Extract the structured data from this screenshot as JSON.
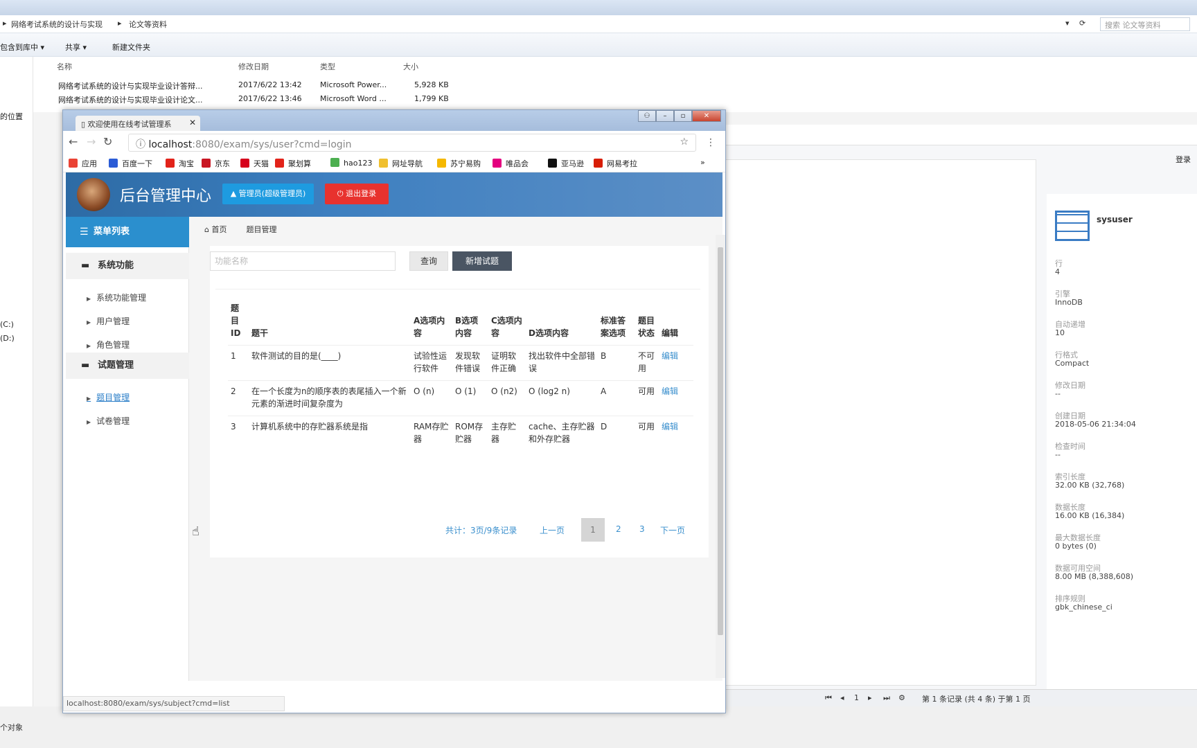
{
  "explorer": {
    "breadcrumb_1": "网络考试系统的设计与实现",
    "breadcrumb_2": "论文等资料",
    "search_placeholder": "搜索 论文等资料",
    "toolbar": [
      "包含到库中 ▾",
      "共享 ▾",
      "新建文件夹"
    ],
    "columns": [
      "名称",
      "修改日期",
      "类型",
      "大小"
    ],
    "files": [
      {
        "name": "网络考试系统的设计与实现毕业设计答辩...",
        "date": "2017/6/22 13:42",
        "type": "Microsoft Power...",
        "size": "5,928 KB"
      },
      {
        "name": "网络考试系统的设计与实现毕业设计论文...",
        "date": "2017/6/22 13:46",
        "type": "Microsoft Word ...",
        "size": "1,799 KB"
      }
    ],
    "left_items": [
      "的位置",
      "(C:)",
      "(D:)"
    ],
    "status": "个对象"
  },
  "db_panel": {
    "login": "登录",
    "table_name": "sysuser",
    "props": [
      {
        "k": "行",
        "v": "4"
      },
      {
        "k": "引擎",
        "v": "InnoDB"
      },
      {
        "k": "自动递增",
        "v": "10"
      },
      {
        "k": "行格式",
        "v": "Compact"
      },
      {
        "k": "修改日期",
        "v": "--"
      },
      {
        "k": "创建日期",
        "v": "2018-05-06 21:34:04"
      },
      {
        "k": "检查时间",
        "v": "--"
      },
      {
        "k": "索引长度",
        "v": "32.00 KB (32,768)"
      },
      {
        "k": "数据长度",
        "v": "16.00 KB (16,384)"
      },
      {
        "k": "最大数据长度",
        "v": "0 bytes (0)"
      },
      {
        "k": "数据可用空间",
        "v": "8.00 MB (8,388,608)"
      },
      {
        "k": "排序规则",
        "v": "gbk_chinese_ci"
      }
    ],
    "footer": "第 1 条记录 (共 4 条) 于第 1 页",
    "page_no": "1"
  },
  "browser": {
    "tab_title": "欢迎使用在线考试管理系",
    "url_host": "localhost",
    "url_path": ":8080/exam/sys/user?cmd=login",
    "bookmarks": [
      {
        "label": "应用",
        "color": "#ea4335"
      },
      {
        "label": "百度一下",
        "color": "#2b5cd6"
      },
      {
        "label": "淘宝",
        "color": "#e2231a"
      },
      {
        "label": "京东",
        "color": "#c91623"
      },
      {
        "label": "天猫",
        "color": "#d6001c"
      },
      {
        "label": "聚划算",
        "color": "#e2231a"
      },
      {
        "label": "hao123",
        "color": "#4caf50"
      },
      {
        "label": "网址导航",
        "color": "#f0c030"
      },
      {
        "label": "苏宁易购",
        "color": "#f5b800"
      },
      {
        "label": "唯品会",
        "color": "#e4007f"
      },
      {
        "label": "亚马逊",
        "color": "#111111"
      },
      {
        "label": "网易考拉",
        "color": "#d81e06"
      }
    ],
    "status_url": "localhost:8080/exam/sys/subject?cmd=list"
  },
  "app": {
    "title": "后台管理中心",
    "admin_btn": "▲ 管理员(超级管理员)",
    "logout_btn": "⏻ 退出登录",
    "menu_title": "菜单列表",
    "groups": [
      {
        "label": "系统功能",
        "items": [
          "系统功能管理",
          "用户管理",
          "角色管理"
        ]
      },
      {
        "label": "试题管理",
        "items": [
          "题目管理",
          "试卷管理"
        ]
      }
    ],
    "breadcrumb": [
      "首页",
      "题目管理"
    ],
    "search_placeholder": "功能名称",
    "query_btn": "查询",
    "new_btn": "新增试题",
    "table": {
      "headers": [
        "题目ID",
        "题干",
        "A选项内容",
        "B选项内容",
        "C选项内容",
        "D选项内容",
        "标准答案选项",
        "题目状态",
        "编辑"
      ],
      "rows": [
        [
          "1",
          "软件测试的目的是(____)",
          "试验性运行软件",
          "发现软件错误",
          "证明软件正确",
          "找出软件中全部错误",
          "B",
          "不可用",
          "编辑"
        ],
        [
          "2",
          "在一个长度为n的顺序表的表尾插入一个新元素的渐进时间复杂度为",
          "O (n)",
          "O (1)",
          "O (n2)",
          "O (log2 n)",
          "A",
          "可用",
          "编辑"
        ],
        [
          "3",
          "计算机系统中的存贮器系统是指",
          "RAM存贮器",
          "ROM存贮器",
          "主存贮器",
          "cache、主存贮器和外存贮器",
          "D",
          "可用",
          "编辑"
        ]
      ]
    },
    "pager": {
      "summary": "共计：3页/9条记录",
      "prev": "上一页",
      "pages": [
        "1",
        "2",
        "3"
      ],
      "next": "下一页"
    }
  }
}
